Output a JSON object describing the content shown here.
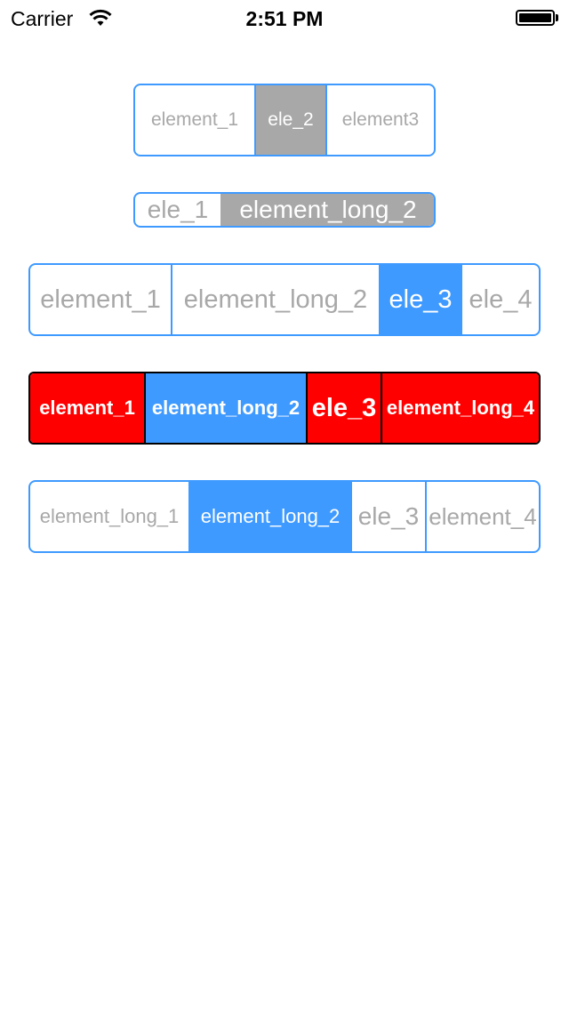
{
  "status_bar": {
    "carrier": "Carrier",
    "time": "2:51 PM",
    "battery_icon": "battery-full-icon",
    "wifi_icon": "wifi-icon"
  },
  "colors": {
    "accent_blue": "#3f9aff",
    "selected_gray": "#a8a8a8",
    "custom_red": "#ff0000",
    "unselected_text": "#a8a8a8"
  },
  "segmented_controls": [
    {
      "items": [
        "element_1",
        "ele_2",
        "element3"
      ],
      "selected_index": 1
    },
    {
      "items": [
        "ele_1",
        "element_long_2"
      ],
      "selected_index": 1
    },
    {
      "items": [
        "element_1",
        "element_long_2",
        "ele_3",
        "ele_4"
      ],
      "selected_index": 2
    },
    {
      "items": [
        "element_1",
        "element_long_2",
        "ele_3",
        "element_long_4"
      ],
      "selected_index": 1
    },
    {
      "items": [
        "element_long_1",
        "element_long_2",
        "ele_3",
        "element_4"
      ],
      "selected_index": 1
    }
  ]
}
